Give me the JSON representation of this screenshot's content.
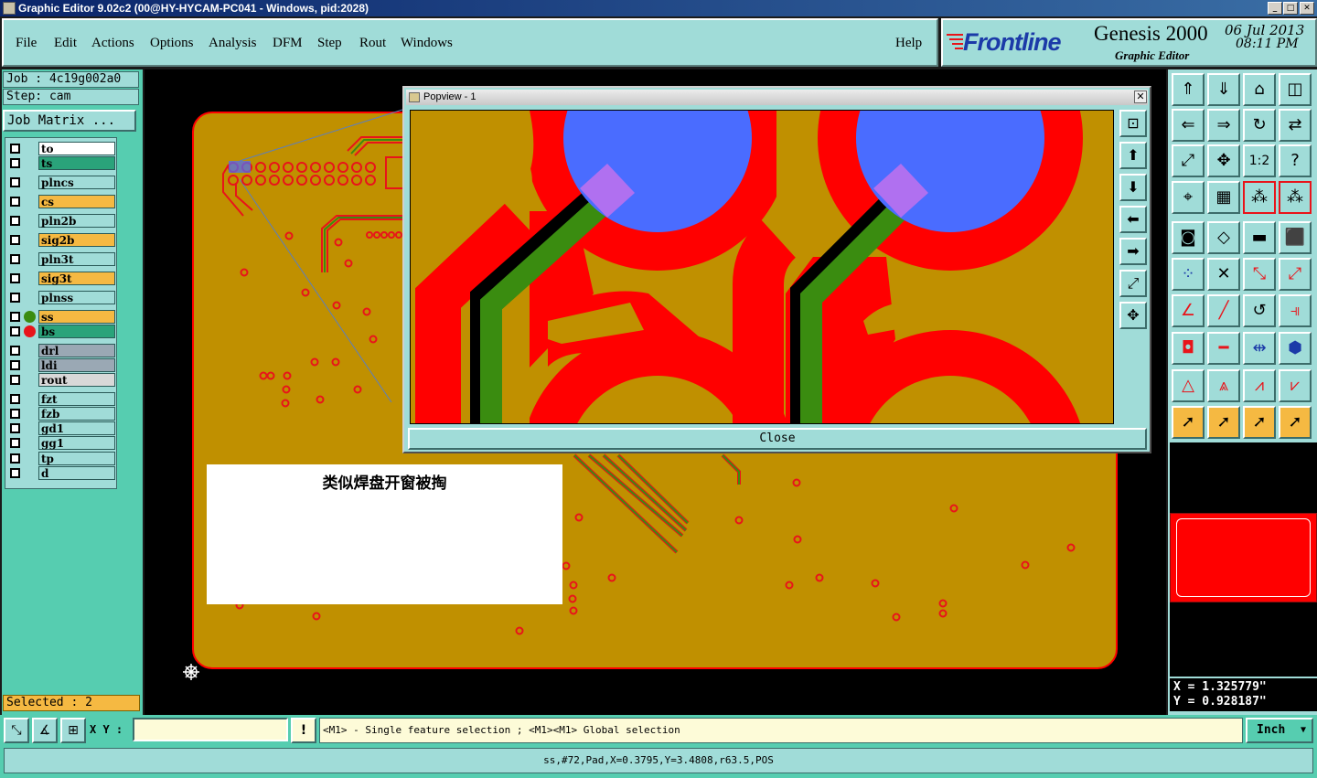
{
  "window": {
    "title": "Graphic Editor 9.02c2 (00@HY-HYCAM-PC041 - Windows, pid:2028)",
    "buttons": [
      "_",
      "□",
      "✕"
    ]
  },
  "menu": {
    "items": [
      "File",
      "Edit",
      "Actions",
      "Options",
      "Analysis",
      "DFM",
      "Step",
      "Rout",
      "Windows"
    ],
    "help": "Help"
  },
  "brand": {
    "logo": "Frontline",
    "product": "Genesis 2000",
    "subtitle": "Graphic Editor",
    "date": "06 Jul 2013",
    "time": "08:11 PM"
  },
  "job": {
    "job_label": "Job : 4c19g002a0",
    "step_label": "Step: cam",
    "matrix_button": "Job Matrix ..."
  },
  "layers": [
    {
      "name": "to",
      "color": "#ffffff"
    },
    {
      "name": "ts",
      "color": "#2aa37a"
    },
    {
      "name": "plncs",
      "color": "#a0dcd8"
    },
    {
      "name": "cs",
      "color": "#f5b942"
    },
    {
      "name": "pln2b",
      "color": "#a0dcd8"
    },
    {
      "name": "sig2b",
      "color": "#f5b942"
    },
    {
      "name": "pln3t",
      "color": "#a0dcd8"
    },
    {
      "name": "sig3t",
      "color": "#f5b942"
    },
    {
      "name": "plnss",
      "color": "#a0dcd8"
    },
    {
      "name": "ss",
      "color": "#f5b942"
    },
    {
      "name": "bs",
      "color": "#2aa37a"
    },
    {
      "name": "drl",
      "color": "#9aa8b4"
    },
    {
      "name": "ldi",
      "color": "#9aa8b4"
    },
    {
      "name": "rout",
      "color": "#d8d8d8"
    },
    {
      "name": "fzt",
      "color": "#a0dcd8"
    },
    {
      "name": "fzb",
      "color": "#a0dcd8"
    },
    {
      "name": "gd1",
      "color": "#a0dcd8"
    },
    {
      "name": "gg1",
      "color": "#a0dcd8"
    },
    {
      "name": "tp",
      "color": "#a0dcd8"
    },
    {
      "name": "d",
      "color": "#a0dcd8"
    }
  ],
  "selected": "Selected : 2",
  "note_text": "类似焊盘开窗被掏",
  "popview": {
    "title": "Popview - 1",
    "close_label": "Close"
  },
  "coords": {
    "x": "X = 1.325779\"",
    "y": "Y = 0.928187\""
  },
  "bottom": {
    "xy_label": "X Y :",
    "xy_value": "",
    "hint": "<M1> - Single feature selection ; <M1><M1> Global selection",
    "units": "Inch",
    "status": "ss,#72,Pad,X=0.3795,Y=3.4808,r63.5,POS"
  },
  "colors": {
    "board": "#c09000",
    "copper": "#ff0000",
    "pad": "#4a6cff",
    "trace": "#3a8c10",
    "panel": "#a0dcd8",
    "panel_dark": "#56cdb0"
  }
}
